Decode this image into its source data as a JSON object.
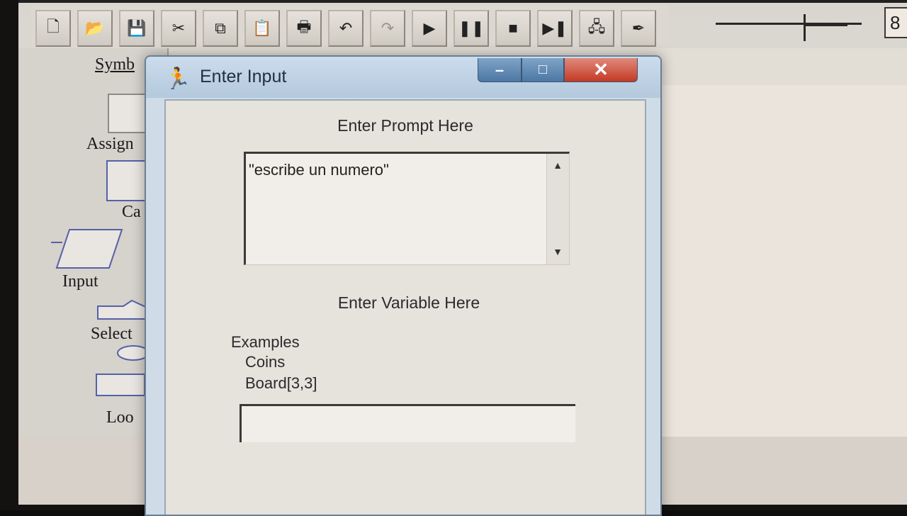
{
  "toolbar": {
    "buttons": [
      {
        "name": "new-button",
        "icon": "new-file-icon",
        "glyph": "🗋",
        "enabled": true
      },
      {
        "name": "open-button",
        "icon": "open-folder-icon",
        "glyph": "📂",
        "enabled": true
      },
      {
        "name": "save-button",
        "icon": "save-disk-icon",
        "glyph": "💾",
        "enabled": true
      },
      {
        "name": "cut-button",
        "icon": "scissors-icon",
        "glyph": "✂",
        "enabled": true
      },
      {
        "name": "copy-button",
        "icon": "copy-icon",
        "glyph": "⧉",
        "enabled": true
      },
      {
        "name": "paste-button",
        "icon": "paste-icon",
        "glyph": "📋",
        "enabled": true
      },
      {
        "name": "print-button",
        "icon": "printer-icon",
        "glyph": "🖶",
        "enabled": true
      },
      {
        "name": "undo-button",
        "icon": "undo-icon",
        "glyph": "↶",
        "enabled": true
      },
      {
        "name": "redo-button",
        "icon": "redo-icon",
        "glyph": "↷",
        "enabled": false
      },
      {
        "name": "play-button",
        "icon": "play-icon",
        "glyph": "▶",
        "enabled": true
      },
      {
        "name": "pause-button",
        "icon": "pause-icon",
        "glyph": "❚❚",
        "enabled": true
      },
      {
        "name": "stop-button",
        "icon": "stop-icon",
        "glyph": "■",
        "enabled": true
      },
      {
        "name": "step-button",
        "icon": "step-icon",
        "glyph": "▶❚",
        "enabled": true
      },
      {
        "name": "test-server-button",
        "icon": "server-icon",
        "glyph": "🖧",
        "enabled": true
      },
      {
        "name": "pen-button",
        "icon": "pen-icon",
        "glyph": "✒",
        "enabled": true
      }
    ],
    "zoom_value": "8"
  },
  "palette": {
    "title": "Symb",
    "items": [
      {
        "label": "Assign"
      },
      {
        "label": "Ca"
      },
      {
        "label": "Input"
      },
      {
        "label": "Select"
      },
      {
        "label": "Loo"
      }
    ]
  },
  "dialog": {
    "title": "Enter Input",
    "prompt_heading": "Enter Prompt Here",
    "prompt_value": "\"escribe un numero\"",
    "variable_heading": "Enter Variable Here",
    "examples_label": "Examples",
    "examples": [
      "Coins",
      "Board[3,3]"
    ],
    "variable_value": "",
    "window_buttons": {
      "minimize": "–",
      "maximize": "□",
      "close": "✕"
    },
    "scroll_up": "▲",
    "scroll_down": "▼"
  },
  "colors": {
    "close_button": "#c33a24",
    "titlebar": "#b4c9dd",
    "symbol_outline": "#5561a8"
  }
}
